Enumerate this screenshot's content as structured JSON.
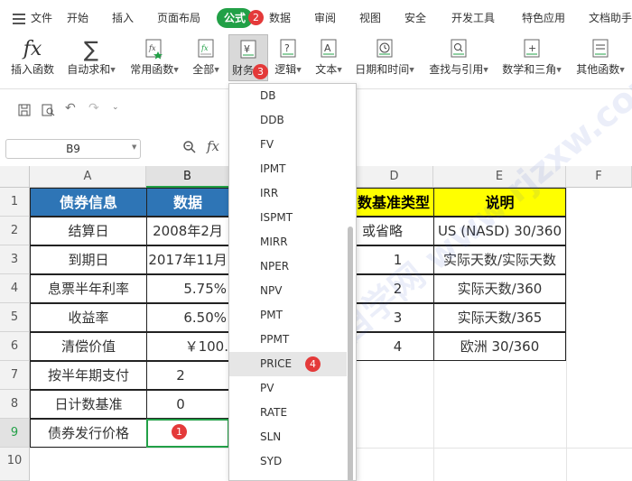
{
  "menubar": {
    "menu_label": "文件",
    "tabs": [
      "开始",
      "插入",
      "页面布局",
      "公式",
      "数据",
      "审阅",
      "视图",
      "安全",
      "开发工具",
      "特色应用",
      "文档助手"
    ],
    "active_tab": "公式"
  },
  "ribbon": {
    "buttons": [
      "插入函数",
      "自动求和",
      "常用函数",
      "全部",
      "财务",
      "逻辑",
      "文本",
      "日期和时间",
      "查找与引用",
      "数学和三角",
      "其他函数"
    ]
  },
  "formula_bar": {
    "name_box": "B9",
    "fx_label": "fx"
  },
  "sheet": {
    "columns": [
      "A",
      "B",
      "C",
      "D",
      "E",
      "F"
    ],
    "rows": [
      "1",
      "2",
      "3",
      "4",
      "5",
      "6",
      "7",
      "8",
      "9",
      "10"
    ],
    "table_a": {
      "header": [
        "债券信息",
        "数据"
      ],
      "rows": [
        [
          "结算日",
          "2008年2月"
        ],
        [
          "到期日",
          "2017年11月"
        ],
        [
          "息票半年利率",
          "5.75%"
        ],
        [
          "收益率",
          "6.50%"
        ],
        [
          "清偿价值",
          "￥100."
        ],
        [
          "按半年期支付",
          "2"
        ],
        [
          "日计数基准",
          "0"
        ],
        [
          "债券发行价格",
          ""
        ]
      ]
    },
    "table_d": {
      "header": [
        "数基准类型",
        "说明"
      ],
      "rows": [
        [
          "或省略",
          "US (NASD) 30/360"
        ],
        [
          "1",
          "实际天数/实际天数"
        ],
        [
          "2",
          "实际天数/360"
        ],
        [
          "3",
          "实际天数/365"
        ],
        [
          "4",
          "欧洲 30/360"
        ]
      ]
    }
  },
  "dropdown": {
    "items": [
      "DB",
      "DDB",
      "FV",
      "IPMT",
      "IRR",
      "ISPMT",
      "MIRR",
      "NPER",
      "NPV",
      "PMT",
      "PPMT",
      "PRICE",
      "PV",
      "RATE",
      "SLN",
      "SYD"
    ],
    "selected": "PRICE"
  },
  "badges": [
    "1",
    "2",
    "3",
    "4"
  ],
  "watermark": "软件自学网 www.rjzxw.com",
  "colors": {
    "accent_green": "#22a047",
    "badge_red": "#e43a3a",
    "header_blue": "#2e75b6",
    "header_yellow": "#ffff00"
  }
}
